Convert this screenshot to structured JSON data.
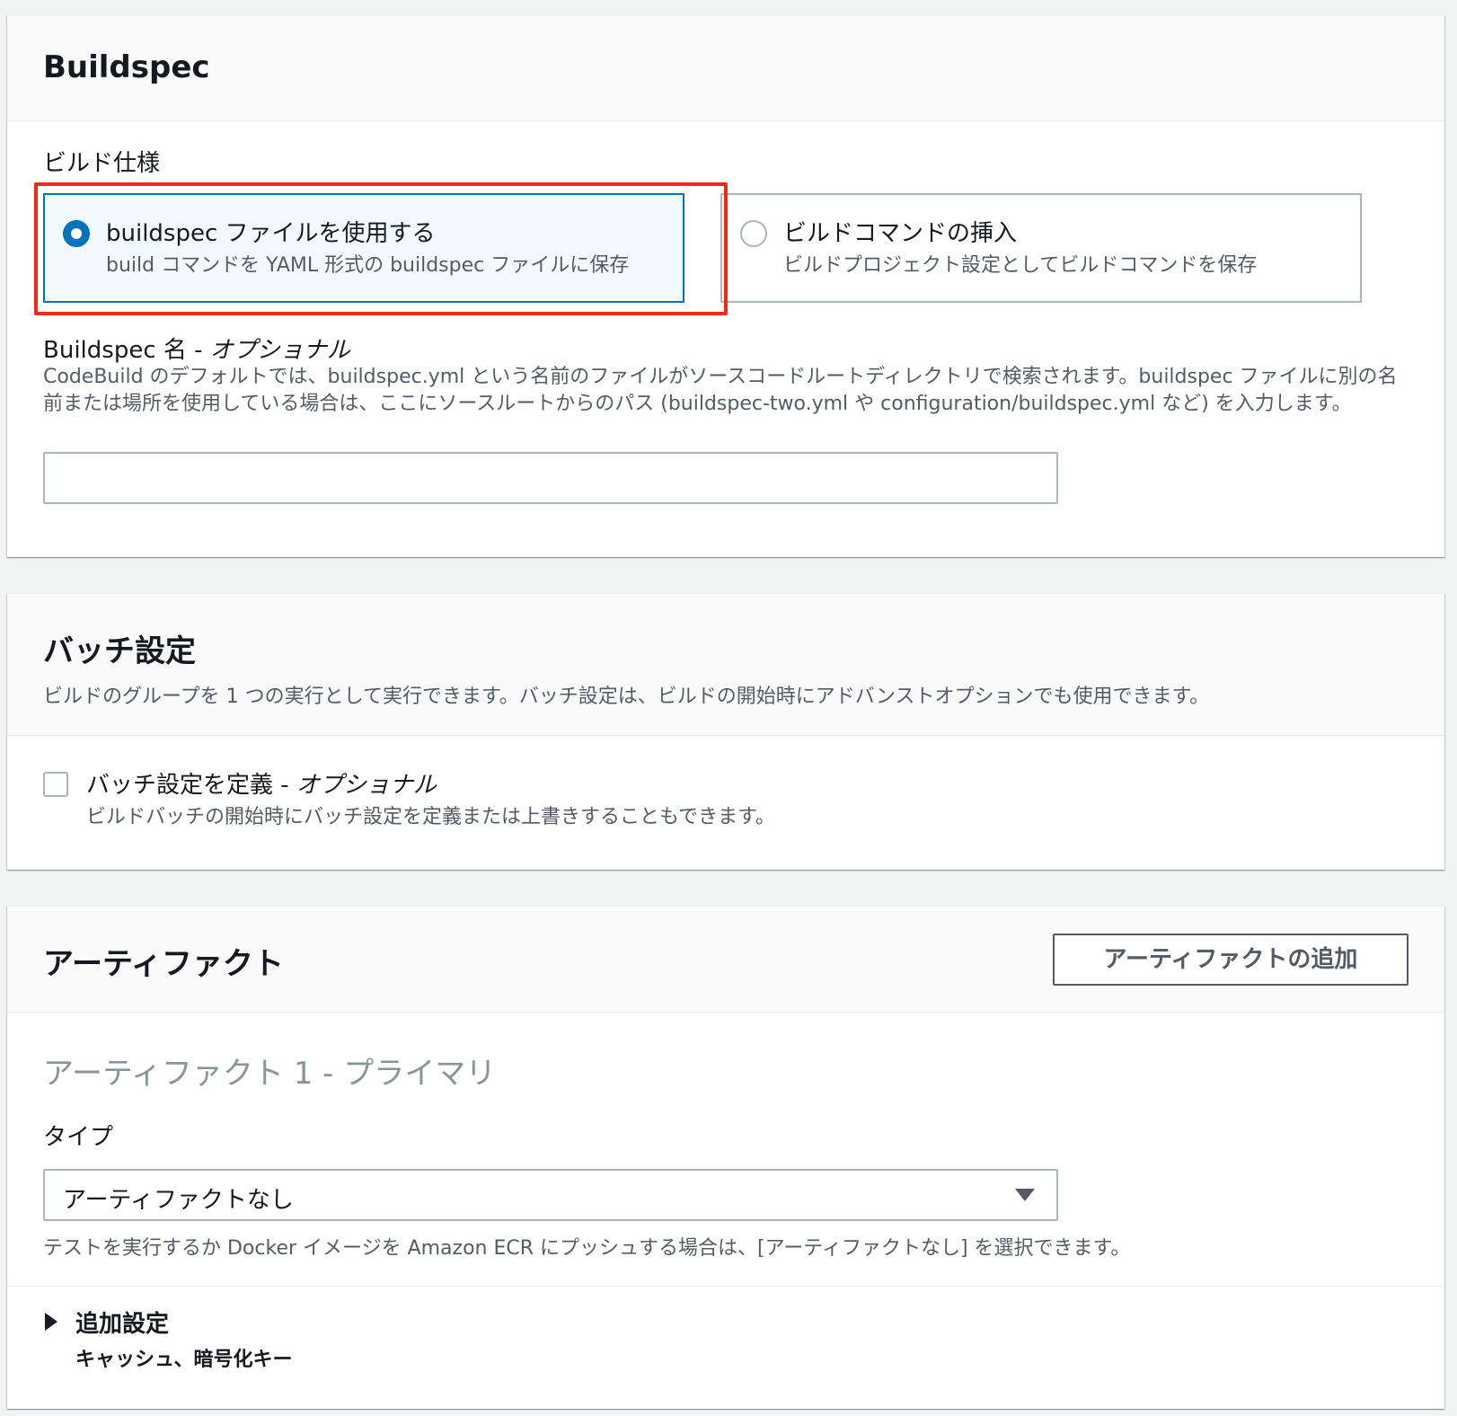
{
  "buildspec": {
    "title": "Buildspec",
    "spec_label": "ビルド仕様",
    "options": [
      {
        "title": "buildspec ファイルを使用する",
        "desc": "build コマンドを YAML 形式の buildspec ファイルに保存",
        "selected": true
      },
      {
        "title": "ビルドコマンドの挿入",
        "desc": "ビルドプロジェクト設定としてビルドコマンドを保存",
        "selected": false
      }
    ],
    "name_label": "Buildspec 名 - ",
    "name_optional": "オプショナル",
    "name_desc": "CodeBuild のデフォルトでは、buildspec.yml という名前のファイルがソースコードルートディレクトリで検索されます。buildspec ファイルに別の名前または場所を使用している場合は、ここにソースルートからのパス (buildspec-two.yml や configuration/buildspec.yml など) を入力します。",
    "name_value": ""
  },
  "batch": {
    "title": "バッチ設定",
    "desc": "ビルドのグループを 1 つの実行として実行できます。バッチ設定は、ビルドの開始時にアドバンストオプションでも使用できます。",
    "checkbox_label": "バッチ設定を定義 - ",
    "checkbox_optional": "オプショナル",
    "checkbox_desc": "ビルドバッチの開始時にバッチ設定を定義または上書きすることもできます。",
    "checked": false
  },
  "artifacts": {
    "title": "アーティファクト",
    "add_button": "アーティファクトの追加",
    "sub_heading": "アーティファクト 1 - プライマリ",
    "type_label": "タイプ",
    "type_value": "アーティファクトなし",
    "hint": "テストを実行するか Docker イメージを Amazon ECR にプッシュする場合は、[アーティファクトなし] を選択できます。",
    "expander_title": "追加設定",
    "expander_desc": "キャッシュ、暗号化キー"
  },
  "colors": {
    "accent": "#0073bb",
    "highlight": "#ee2b16"
  }
}
